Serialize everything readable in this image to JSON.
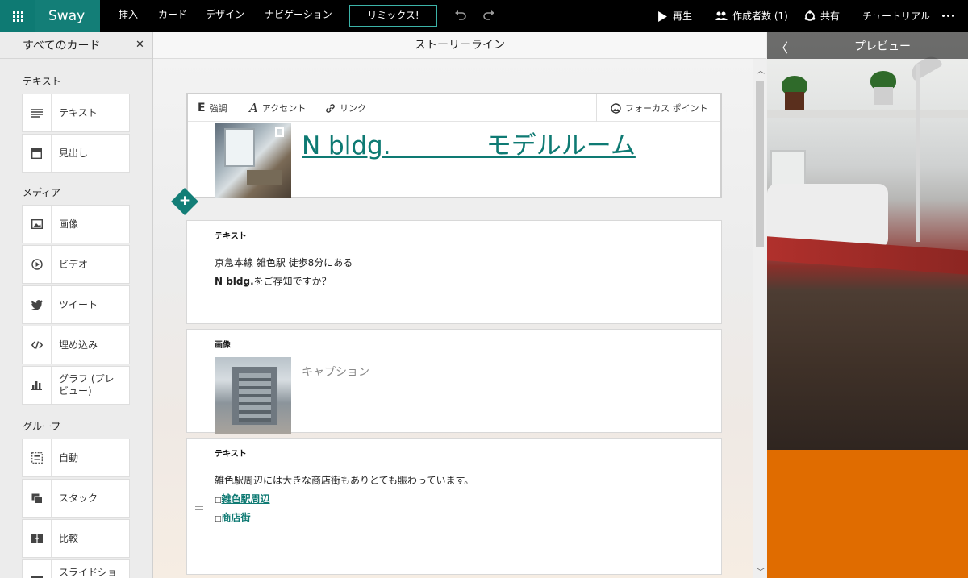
{
  "app": {
    "name": "Sway"
  },
  "menu": {
    "items": [
      "挿入",
      "カード",
      "デザイン",
      "ナビゲーション"
    ],
    "remix_label": "リミックス!"
  },
  "toolbar_right": {
    "play": "再生",
    "authors": "作成者数 (1)",
    "share": "共有",
    "tutorial": "チュートリアル"
  },
  "sidebar": {
    "title": "すべてのカード",
    "sections": [
      {
        "label": "テキスト",
        "items": [
          "テキスト",
          "見出し"
        ]
      },
      {
        "label": "メディア",
        "items": [
          "画像",
          "ビデオ",
          "ツイート",
          "埋め込み",
          "グラフ (プレビュー)"
        ]
      },
      {
        "label": "グループ",
        "items": [
          "自動",
          "スタック",
          "比較",
          "スライドショー"
        ]
      }
    ]
  },
  "storyline": {
    "title": "ストーリーライン",
    "format_bar": {
      "emphasis": "強調",
      "accent": "アクセント",
      "link": "リンク",
      "focus": "フォーカス ポイント"
    },
    "title_card": {
      "title": "N bldg.            モデルルーム"
    },
    "text_card_1": {
      "label": "テキスト",
      "line1": "京急本線 雑色駅 徒歩8分にある",
      "line2_bold": "N bldg.",
      "line2_rest": "をご存知ですか？"
    },
    "image_card": {
      "label": "画像",
      "caption": "キャプション"
    },
    "text_card_2": {
      "label": "テキスト",
      "line1": "雑色駅周辺には大きな商店街もありとても賑わっています。",
      "link1": "雑色駅周辺",
      "link2": "商店街",
      "bullet": "□"
    }
  },
  "preview": {
    "title": "プレビュー"
  },
  "colors": {
    "brand": "#137e77",
    "topbar": "#000000",
    "preview_accent": "#e06c00"
  }
}
